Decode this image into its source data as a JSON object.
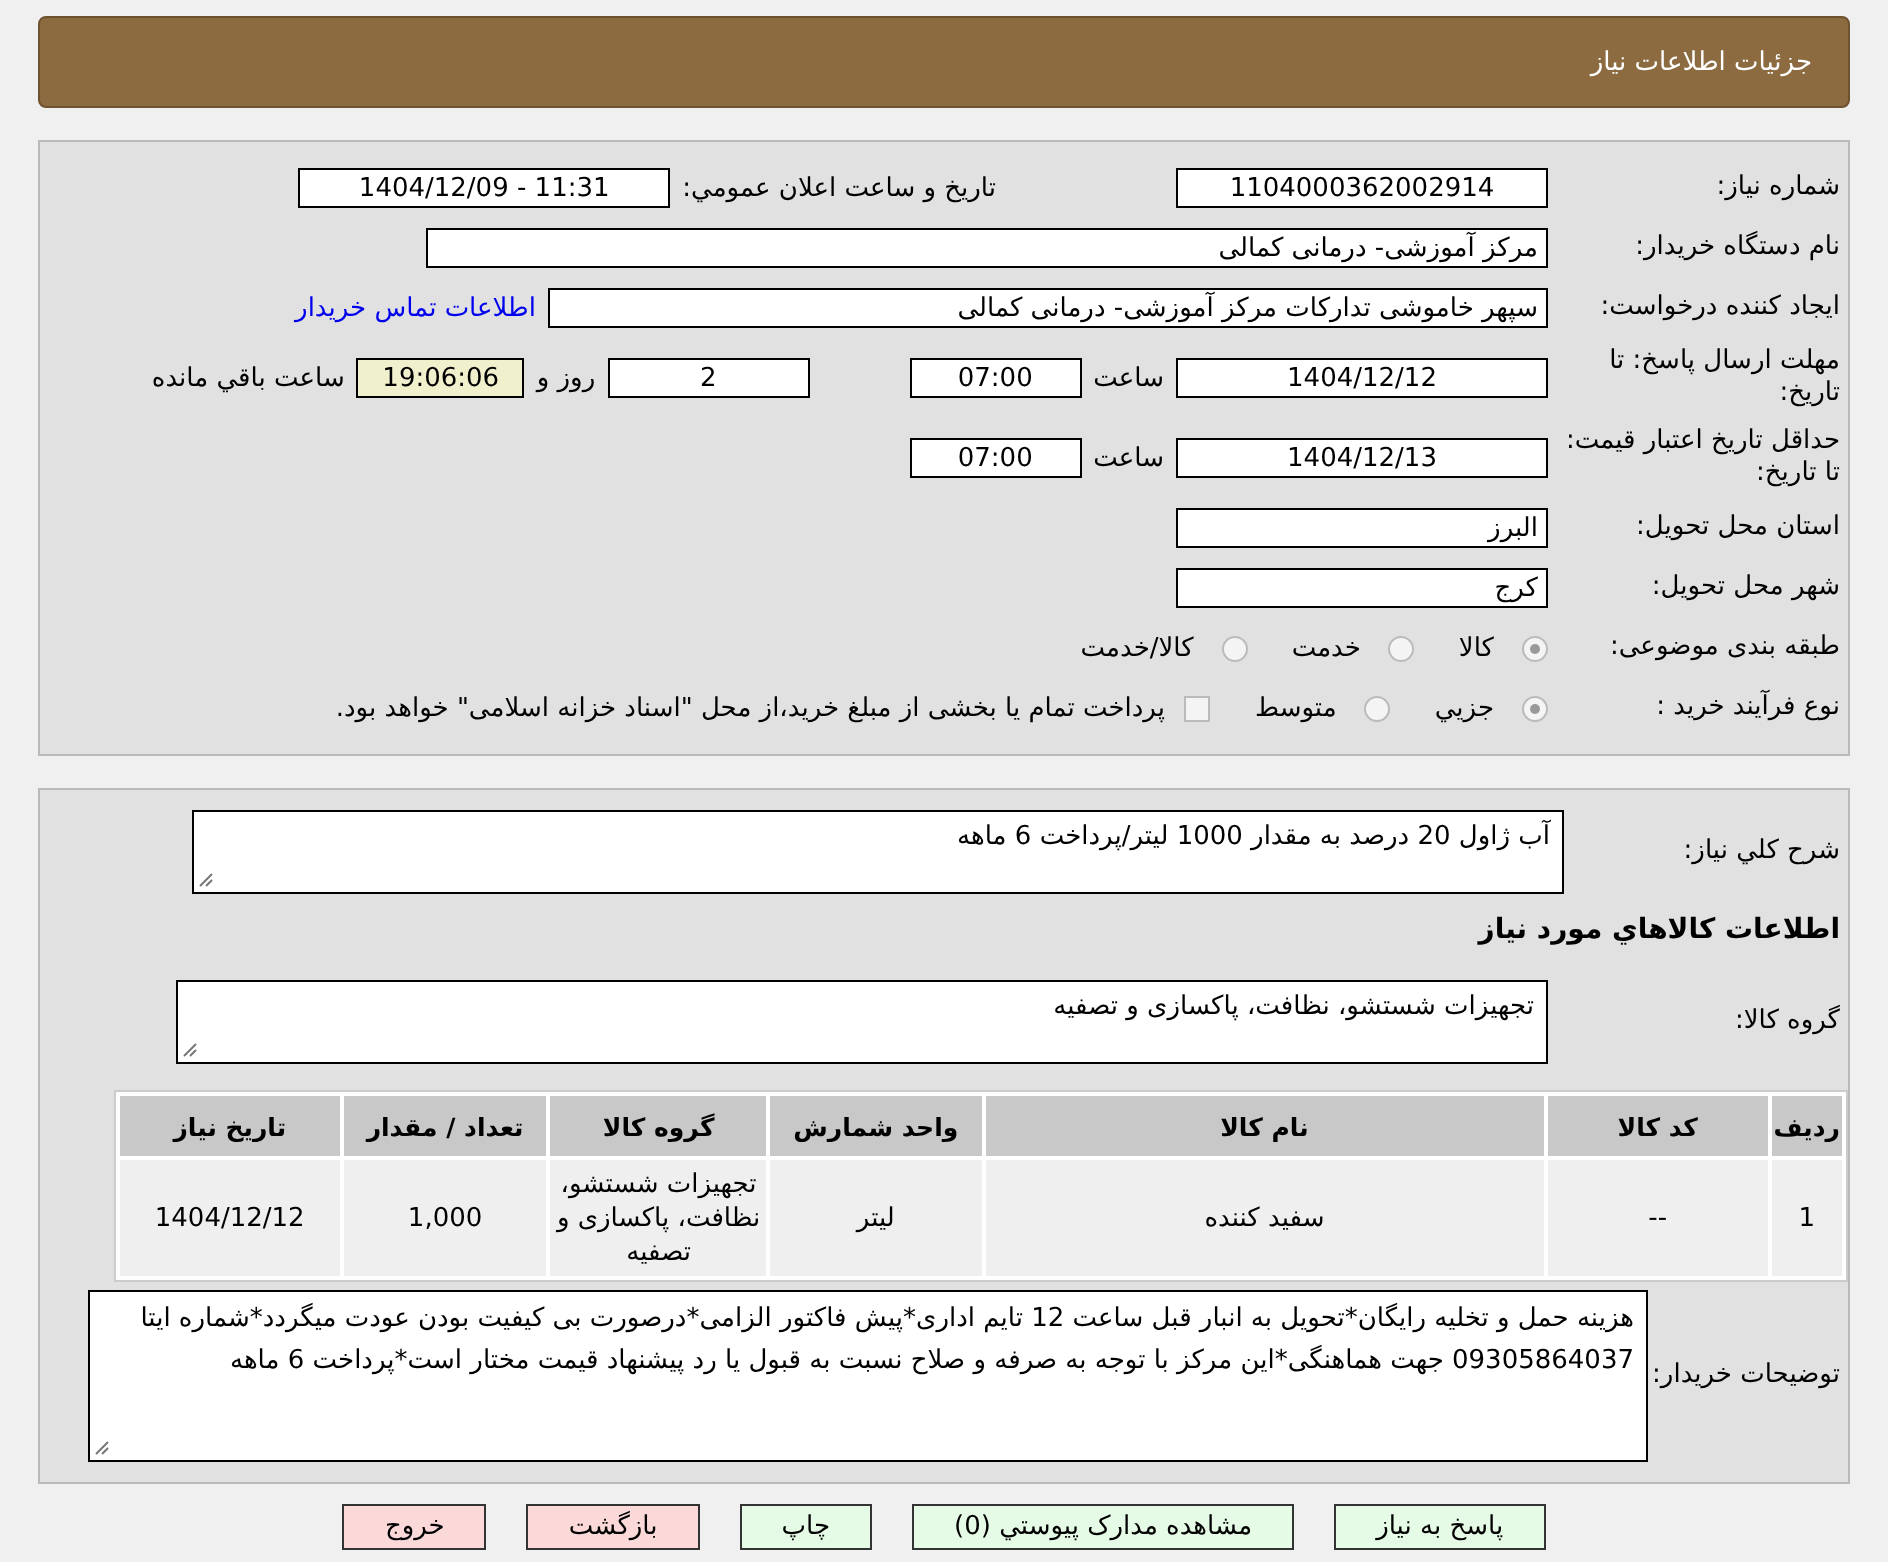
{
  "header": {
    "title": "جزئیات اطلاعات نیاز"
  },
  "need_number": {
    "label": "شماره نیاز:",
    "value": "1104000362002914"
  },
  "announce": {
    "label": "تاريخ و ساعت اعلان عمومي:",
    "value": "1404/12/09 - 11:31"
  },
  "buyer_org": {
    "label": "نام دستگاه خريدار:",
    "value": "مرکز آموزشی- درمانی کمالی"
  },
  "requester": {
    "label": "ايجاد کننده درخواست:",
    "value": "سپهر خاموشی تدارکات مرکز آموزشی- درمانی کمالی",
    "link": "اطلاعات تماس خريدار"
  },
  "response_deadline": {
    "label": "مهلت ارسال پاسخ: تا تاريخ:",
    "date": "1404/12/12",
    "time_label": "ساعت",
    "time": "07:00",
    "days": "2",
    "days_label": "روز و",
    "remaining": "19:06:06",
    "remaining_label": "ساعت باقي مانده"
  },
  "price_validity": {
    "label": "حداقل تاريخ اعتبار قيمت: تا تاريخ:",
    "date": "1404/12/13",
    "time_label": "ساعت",
    "time": "07:00"
  },
  "province": {
    "label": "استان محل تحويل:",
    "value": "البرز"
  },
  "city": {
    "label": "شهر محل تحويل:",
    "value": "کرج"
  },
  "category": {
    "label": "طبقه بندی موضوعی:",
    "options": [
      {
        "label": "کالا",
        "selected": true
      },
      {
        "label": "خدمت",
        "selected": false
      },
      {
        "label": "کالا/خدمت",
        "selected": false
      }
    ]
  },
  "process": {
    "label": "نوع فرآيند خريد :",
    "options": [
      {
        "label": "جزيي",
        "selected": true
      },
      {
        "label": "متوسط",
        "selected": false
      }
    ],
    "treasury": {
      "checked": false,
      "text": "پرداخت تمام یا بخشی از مبلغ خرید،از محل \"اسناد خزانه اسلامی\" خواهد بود."
    }
  },
  "description": {
    "label": "شرح کلي نياز:",
    "value": "آب ژاول 20 درصد به مقدار 1000 لیتر/پرداخت 6 ماهه"
  },
  "goods_heading": "اطلاعات کالاهاي مورد نياز",
  "goods_group": {
    "label": "گروه کالا:",
    "value": "تجهیزات شستشو، نظافت، پاکسازی و تصفیه"
  },
  "table": {
    "columns": [
      "رديف",
      "کد کالا",
      "نام کالا",
      "واحد شمارش",
      "گروه کالا",
      "تعداد / مقدار",
      "تاريخ نياز"
    ],
    "rows": [
      [
        "1",
        "--",
        "سفید کننده",
        "لیتر",
        "تجهیزات شستشو، نظافت، پاکسازی و تصفیه",
        "1,000",
        "1404/12/12"
      ]
    ]
  },
  "buyer_notes": {
    "label": "توضيحات خريدار:",
    "value": "هزینه حمل و تخلیه رایگان*تحویل به انبار قبل ساعت 12 تایم اداری*پیش فاکتور الزامی*درصورت بی کیفیت بودن عودت میگردد*شماره ایتا 09305864037 جهت هماهنگی*این مرکز با توجه به صرفه و صلاح نسبت به قبول یا رد پیشنهاد قیمت مختار است*پرداخت 6 ماهه"
  },
  "buttons": [
    {
      "label": "پاسخ به نياز",
      "kind": "action"
    },
    {
      "label": "مشاهده مدارک پيوستي (0)",
      "kind": "action"
    },
    {
      "label": "چاپ",
      "kind": "action"
    },
    {
      "label": "بازگشت",
      "kind": "leave"
    },
    {
      "label": "خروج",
      "kind": "leave"
    }
  ]
}
